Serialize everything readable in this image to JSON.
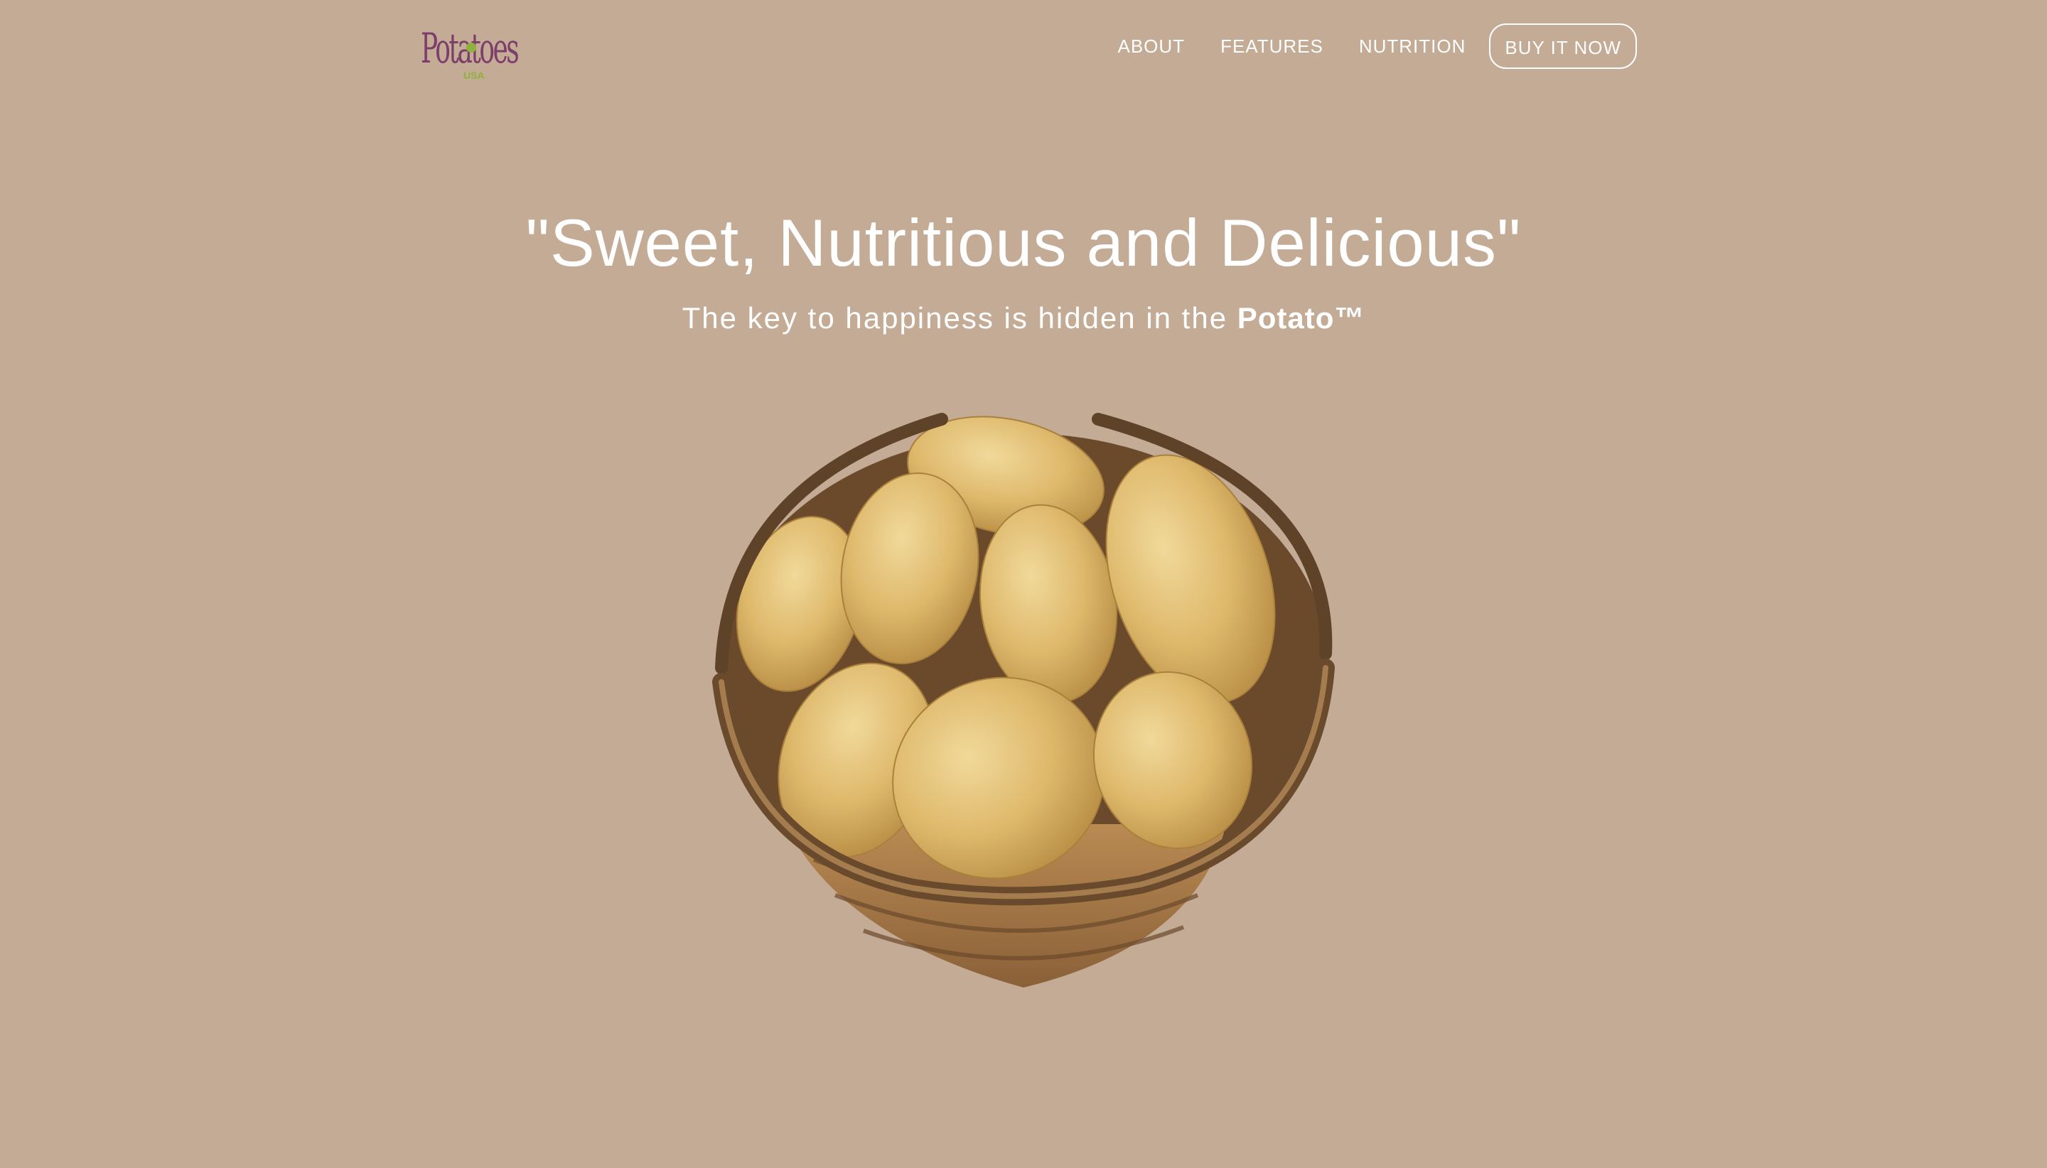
{
  "header": {
    "logo": {
      "wordmark": "Potatoes",
      "sub": "USA"
    },
    "nav": [
      {
        "label": "ABOUT"
      },
      {
        "label": "FEATURES"
      },
      {
        "label": "NUTRITION"
      }
    ],
    "cta_label": "BUY IT NOW"
  },
  "hero": {
    "title": "\"Sweet, Nutritious and Delicious\"",
    "subtitle_prefix": "The key to happiness is hidden in the ",
    "subtitle_brand": "Potato™"
  },
  "colors": {
    "background": "#c4ab95",
    "text": "#ffffff",
    "logo_purple": "#7d3f6a",
    "logo_green": "#8fb23e"
  },
  "image": {
    "name": "basket-of-potatoes"
  }
}
